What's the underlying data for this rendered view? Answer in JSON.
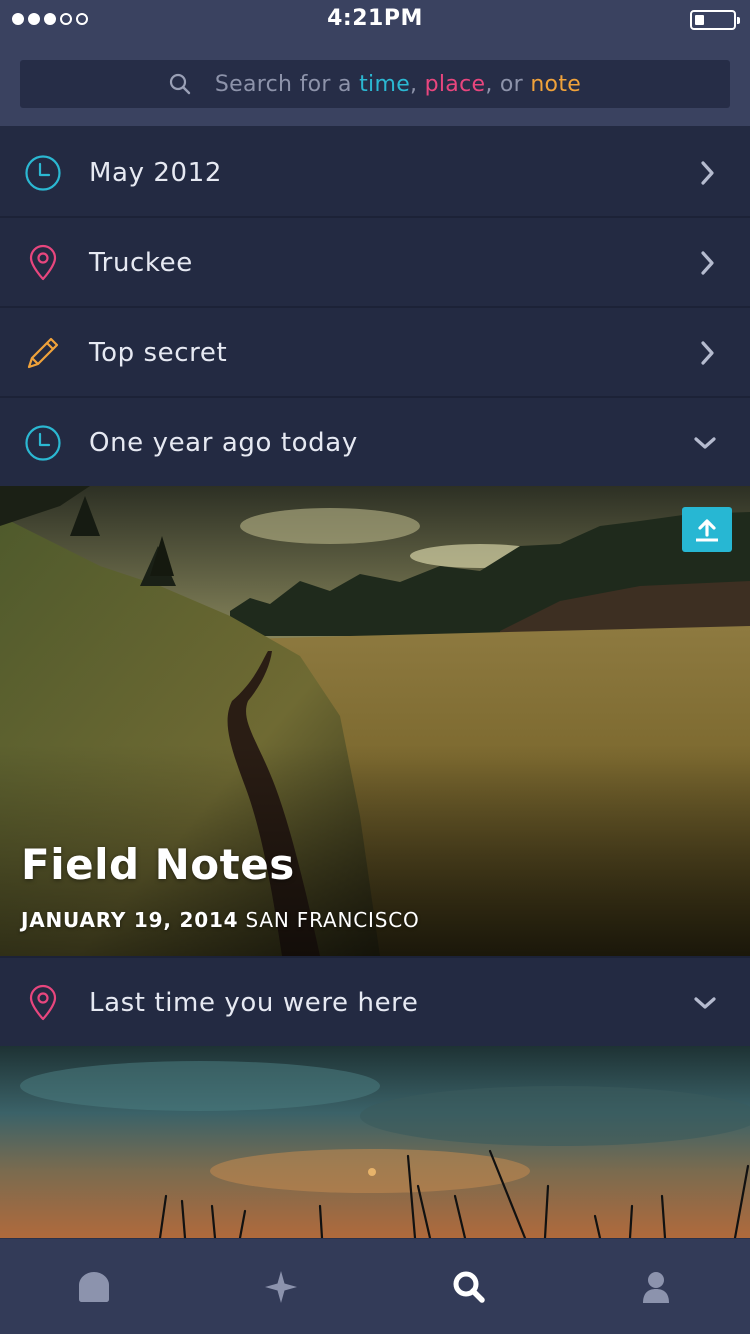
{
  "status_bar": {
    "signal_bars_filled": 3,
    "signal_bars_total": 5,
    "time": "4:21PM",
    "battery_level": 0.25
  },
  "search": {
    "prefix": "Search for a ",
    "kw_time": "time",
    "sep1": ", ",
    "kw_place": "place",
    "sep2": ", or ",
    "kw_note": "note",
    "icon": "search-icon"
  },
  "colors": {
    "time": "#2bb8d2",
    "place": "#e8467e",
    "note": "#f0a23a",
    "accent": "#27b7d3"
  },
  "rows": [
    {
      "label": "May 2012",
      "icon": "clock-icon",
      "action": "chevron-right"
    },
    {
      "label": "Truckee",
      "icon": "location-pin-icon",
      "action": "chevron-right"
    },
    {
      "label": "Top secret",
      "icon": "pencil-icon",
      "action": "chevron-right"
    },
    {
      "label": "One year ago today",
      "icon": "clock-icon",
      "action": "chevron-down"
    },
    {
      "label": "Last time you were here",
      "icon": "location-pin-icon",
      "action": "chevron-down"
    }
  ],
  "card": {
    "title": "Field Notes",
    "date": "JANUARY 19, 2014",
    "location": " SAN FRANCISCO",
    "share_icon": "upload-icon"
  },
  "tabbar": [
    {
      "name": "home",
      "icon": "home-icon",
      "active": false
    },
    {
      "name": "featured",
      "icon": "star-icon",
      "active": false
    },
    {
      "name": "search",
      "icon": "search-icon",
      "active": true
    },
    {
      "name": "profile",
      "icon": "person-icon",
      "active": false
    }
  ]
}
